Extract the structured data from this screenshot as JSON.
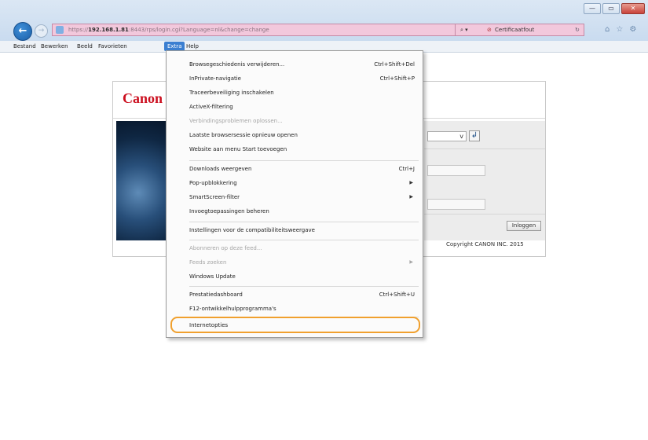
{
  "browser": {
    "url_prefix": "https://",
    "url_host": "192.168.1.81",
    "url_path": ":8443/rps/login.cgi?Language=nl&change=change",
    "search_icon": "search-icon",
    "cert_error": "Certificaatfout",
    "window_controls": [
      "—",
      "▭",
      "✕"
    ]
  },
  "menubar": {
    "items": [
      "Bestand",
      "Bewerken",
      "Beeld",
      "Favorieten",
      "Extra",
      "Help"
    ],
    "active": "Extra"
  },
  "page": {
    "logo": "Canon",
    "language_select": "v",
    "login_button": "Inloggen",
    "copyright": "Copyright CANON INC. 2015"
  },
  "menu": {
    "items": [
      {
        "label": "Browsegeschiedenis verwijderen...",
        "shortcut": "Ctrl+Shift+Del"
      },
      {
        "label": "InPrivate-navigatie",
        "shortcut": "Ctrl+Shift+P"
      },
      {
        "label": "Traceerbeveiliging inschakelen",
        "shortcut": ""
      },
      {
        "label": "ActiveX-filtering",
        "shortcut": ""
      },
      {
        "label": "Verbindingsproblemen oplossen...",
        "shortcut": "",
        "disabled": true
      },
      {
        "label": "Laatste browsersessie opnieuw openen",
        "shortcut": ""
      },
      {
        "label": "Website aan menu Start toevoegen",
        "shortcut": ""
      },
      {
        "label": "Downloads weergeven",
        "shortcut": "Ctrl+J"
      },
      {
        "label": "Pop-upblokkering",
        "submenu": true
      },
      {
        "label": "SmartScreen-filter",
        "submenu": true
      },
      {
        "label": "Invoegtoepassingen beheren",
        "shortcut": ""
      },
      {
        "label": "Instellingen voor de compatibiliteitsweergave",
        "shortcut": ""
      },
      {
        "label": "Abonneren op deze feed...",
        "shortcut": "",
        "disabled": true
      },
      {
        "label": "Feeds zoeken",
        "submenu": true,
        "disabled": true
      },
      {
        "label": "Windows Update",
        "shortcut": ""
      },
      {
        "label": "Prestatiedashboard",
        "shortcut": "Ctrl+Shift+U"
      },
      {
        "label": "F12-ontwikkelhulpprogramma's",
        "shortcut": ""
      },
      {
        "label": "Internetopties",
        "shortcut": "",
        "highlighted": true
      }
    ]
  }
}
